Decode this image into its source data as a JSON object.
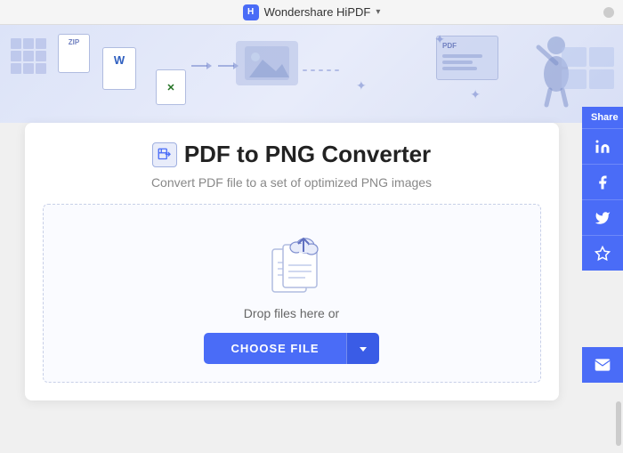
{
  "titleBar": {
    "appName": "Wondershare HiPDF",
    "dropdownIcon": "▾"
  },
  "converter": {
    "title": "PDF to PNG Converter",
    "subtitle": "Convert PDF file to a set of optimized PNG images",
    "dropZone": {
      "dropText": "Drop files here or",
      "chooseFileLabel": "CHOOSE FILE",
      "dropdownArrow": "▾"
    }
  },
  "shareSidebar": {
    "shareLabel": "Share",
    "buttons": [
      {
        "name": "linkedin",
        "icon": "linkedin-icon"
      },
      {
        "name": "facebook",
        "icon": "facebook-icon"
      },
      {
        "name": "twitter",
        "icon": "twitter-icon"
      },
      {
        "name": "star",
        "icon": "star-icon"
      }
    ],
    "emailButton": {
      "name": "email",
      "icon": "email-icon"
    }
  },
  "colors": {
    "accent": "#4a6cf7",
    "accentDark": "#3a5ce6",
    "bannerBg": "#dce3f8",
    "textPrimary": "#222",
    "textSecondary": "#888"
  }
}
